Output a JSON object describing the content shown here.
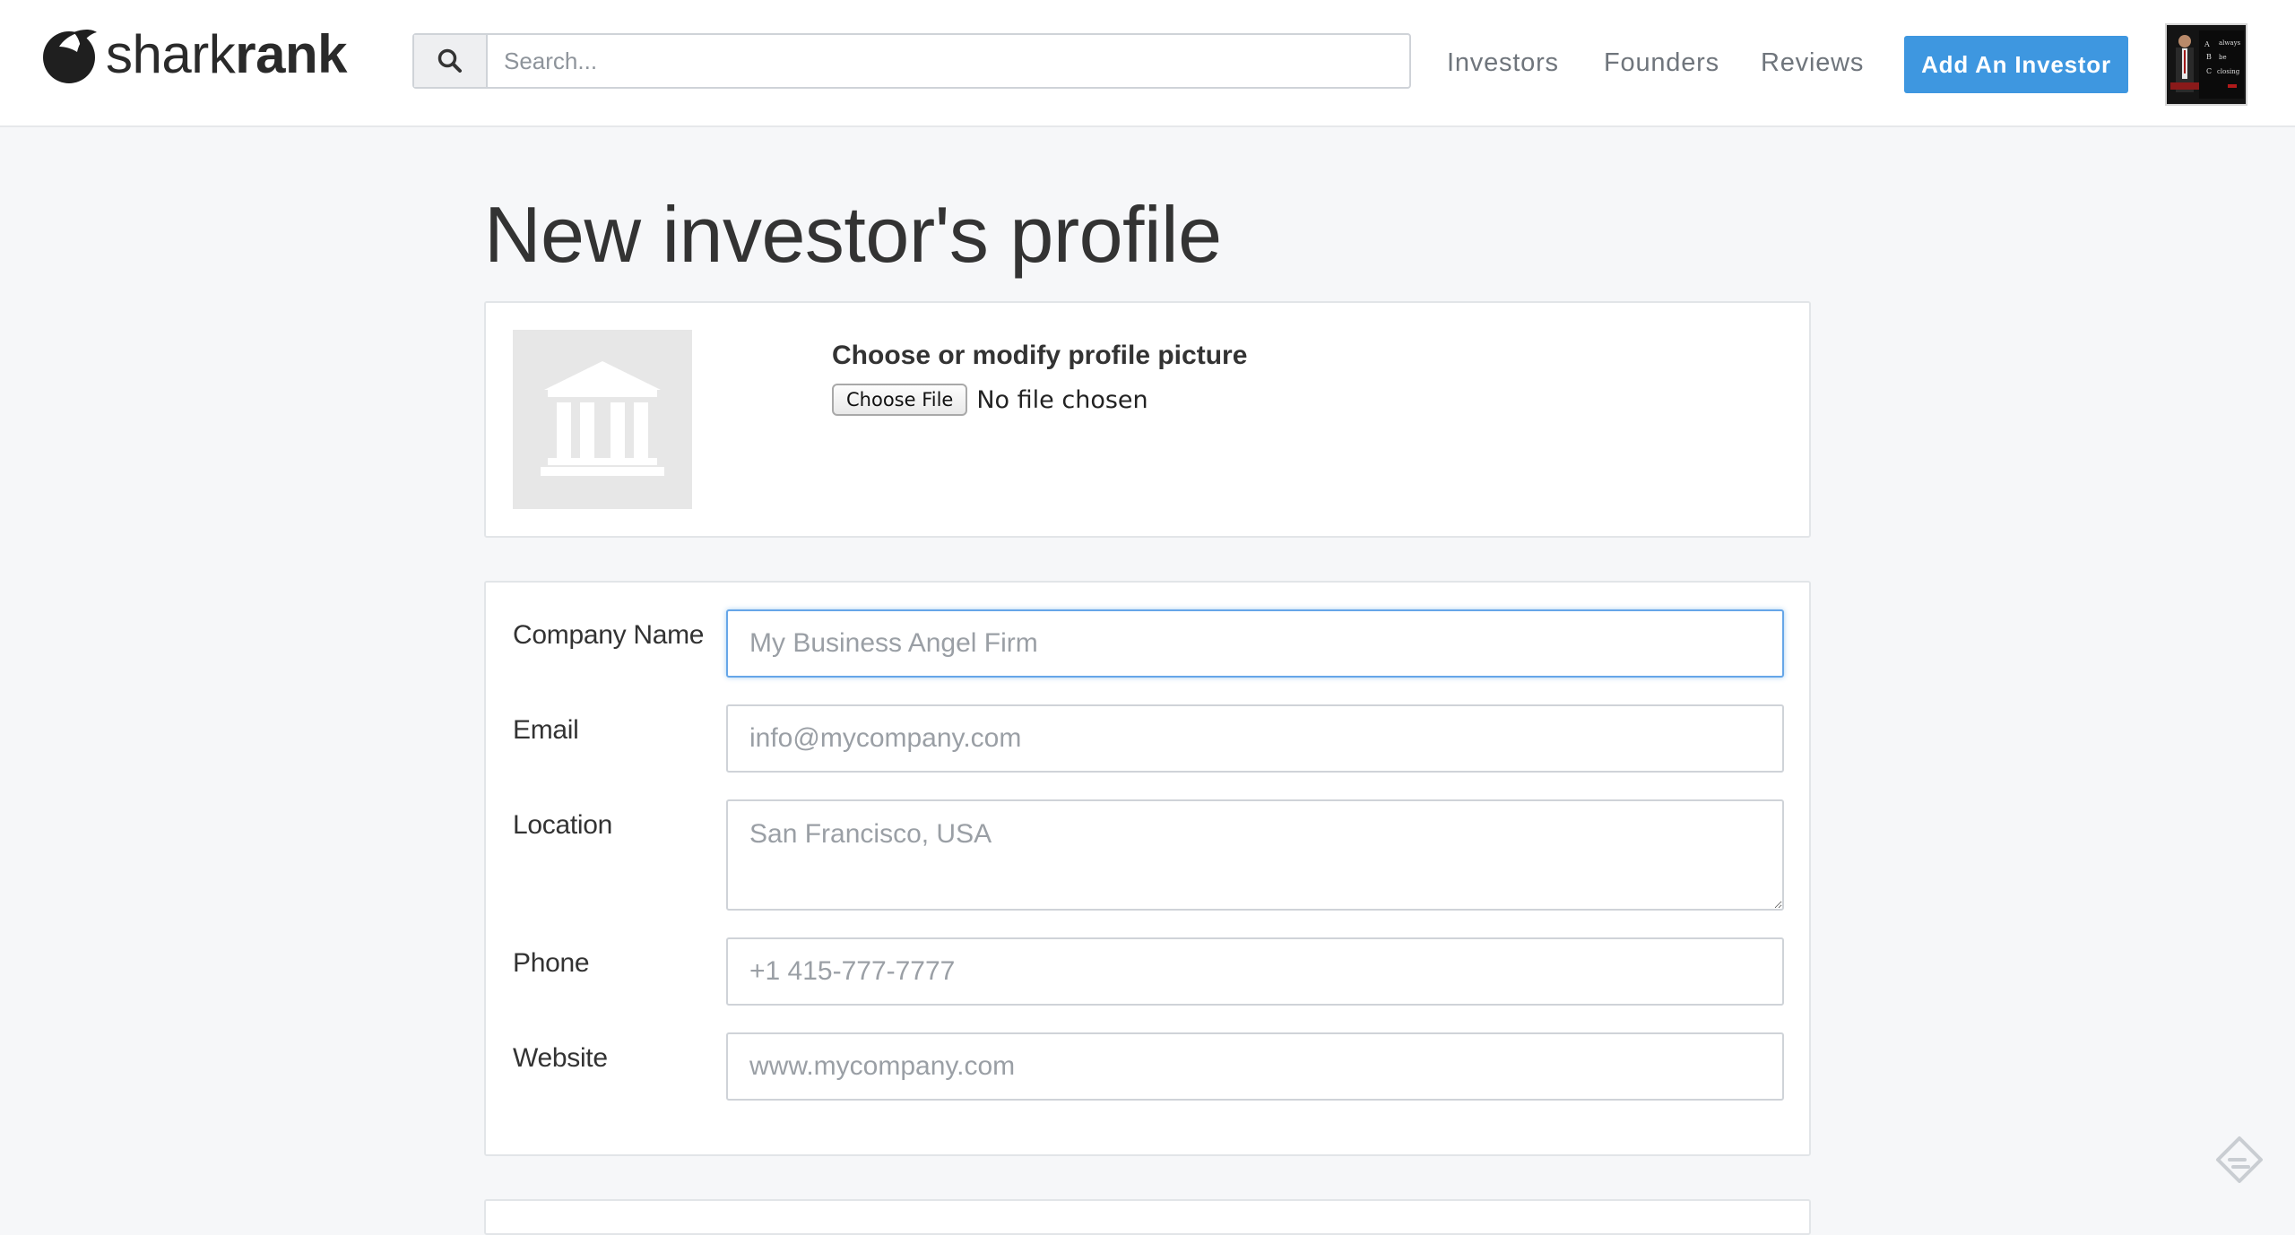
{
  "header": {
    "logo": {
      "text_light": "shark",
      "text_bold": "rank"
    },
    "search": {
      "placeholder": "Search...",
      "icon": "search-icon"
    },
    "nav": [
      "Investors",
      "Founders",
      "Reviews"
    ],
    "add_button": "Add An Investor",
    "avatar_icon": "user-avatar"
  },
  "page": {
    "title": "New investor's profile",
    "profile_picture": {
      "heading": "Choose or modify profile picture",
      "choose_file": "Choose File",
      "status": "No file chosen",
      "placeholder_icon": "bank-building-icon"
    },
    "form": {
      "fields": [
        {
          "label": "Company Name",
          "placeholder": "My Business Angel Firm",
          "focused": true
        },
        {
          "label": "Email",
          "placeholder": "info@mycompany.com"
        },
        {
          "label": "Location",
          "placeholder": "San Francisco, USA",
          "multiline": true
        },
        {
          "label": "Phone",
          "placeholder": "+1 415-777-7777"
        },
        {
          "label": "Website",
          "placeholder": "www.mycompany.com"
        }
      ]
    }
  },
  "colors": {
    "accent": "#3e97e0",
    "background": "#f6f7f9",
    "text": "#333333",
    "nav_text": "#6f757c"
  }
}
